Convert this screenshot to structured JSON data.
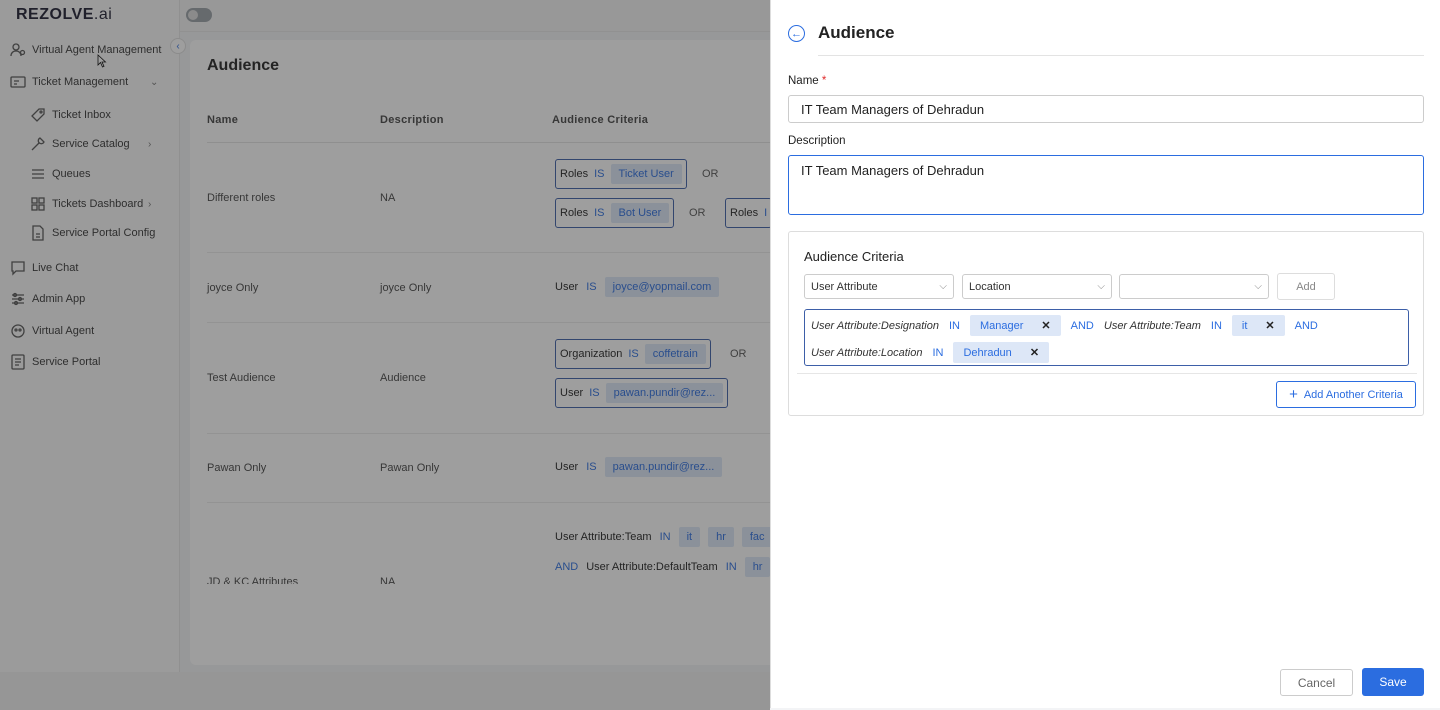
{
  "app": {
    "logo": "REZOLVE.ai",
    "logo_main": "REZOLVE",
    "logo_suffix": ".ai"
  },
  "sidebar": {
    "items": [
      {
        "label": "Virtual Agent Management",
        "icon": "users-cog-icon"
      },
      {
        "label": "Ticket Management",
        "icon": "ticket-icon"
      },
      {
        "label": "Ticket Inbox",
        "icon": "tag-icon"
      },
      {
        "label": "Service Catalog",
        "icon": "wrench-icon"
      },
      {
        "label": "Queues",
        "icon": "list-icon"
      },
      {
        "label": "Tickets Dashboard",
        "icon": "grid-icon"
      },
      {
        "label": "Service Portal Config",
        "icon": "document-icon"
      },
      {
        "label": "Live Chat",
        "icon": "chat-icon"
      },
      {
        "label": "Admin App",
        "icon": "sliders-icon"
      },
      {
        "label": "Virtual Agent",
        "icon": "bot-icon"
      },
      {
        "label": "Service Portal",
        "icon": "portal-icon"
      }
    ]
  },
  "main": {
    "title": "Audience",
    "columns": [
      "Name",
      "Description",
      "Audience Criteria"
    ],
    "rows": [
      {
        "name": "Different roles",
        "description": "NA"
      },
      {
        "name": "joyce Only",
        "description": "joyce Only"
      },
      {
        "name": "Test Audience",
        "description": "Audience"
      },
      {
        "name": "Pawan Only",
        "description": "Pawan Only"
      },
      {
        "name": "JD & KC Attributes",
        "description": "NA"
      }
    ],
    "criteria": {
      "roles": "Roles",
      "is": "IS",
      "or": "OR",
      "and": "AND",
      "in": "IN",
      "user": "User",
      "organization": "Organization",
      "ticket_user": "Ticket User",
      "bot_user": "Bot User",
      "roles_trunc": "Roles",
      "is_trunc": "I",
      "joyce_email": "joyce@yopmail.com",
      "org_value": "coffetrain",
      "pawan_email": "pawan.pundir@rez...",
      "team_attr": "User Attribute:Team",
      "default_team_attr": "User Attribute:DefaultTeam",
      "team_it": "it",
      "team_hr": "hr",
      "team_fac": "fac",
      "default_hr": "hr"
    }
  },
  "drawer": {
    "title": "Audience",
    "name_label": "Name",
    "required_mark": "*",
    "name_value": "IT Team Managers of Dehradun",
    "description_label": "Description",
    "description_value": "IT Team Managers of Dehradun",
    "criteria_title": "Audience Criteria",
    "select_1": "User Attribute",
    "select_2": "Location",
    "select_3": "",
    "add_label": "Add",
    "conditions": {
      "designation_attr": "User Attribute:Designation",
      "designation_op": "IN",
      "designation_value": "Manager",
      "and_1": "AND",
      "team_attr": "User Attribute:Team",
      "team_op": "IN",
      "team_value": "it",
      "and_2": "AND",
      "location_attr": "User Attribute:Location",
      "location_op": "IN",
      "location_value": "Dehradun"
    },
    "add_another_label": "Add Another Criteria",
    "cancel_label": "Cancel",
    "save_label": "Save"
  },
  "colors": {
    "accent": "#2b6de0",
    "tag_bg": "#dde7f7",
    "required": "#e02b2b"
  }
}
